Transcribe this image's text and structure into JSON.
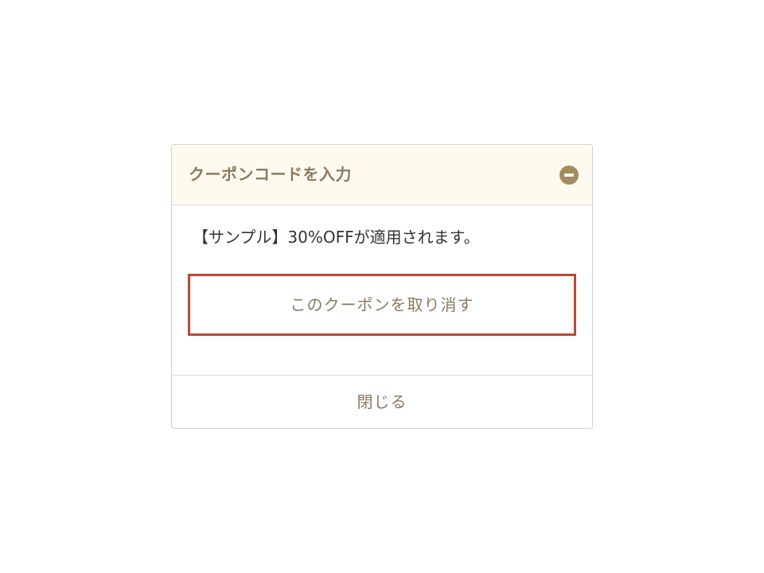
{
  "coupon_panel": {
    "header": {
      "title": "クーポンコードを入力",
      "collapse_icon": "minus-circle-icon",
      "background_color": "#fffaee",
      "icon_color": "#a18d5f"
    },
    "message": "【サンプル】30%OFFが適用されます。",
    "cancel_button": {
      "label": "このクーポンを取り消す",
      "highlight_color": "#b84934"
    },
    "close_button": {
      "label": "閉じる"
    },
    "accent_text_color": "#8b7b61"
  }
}
